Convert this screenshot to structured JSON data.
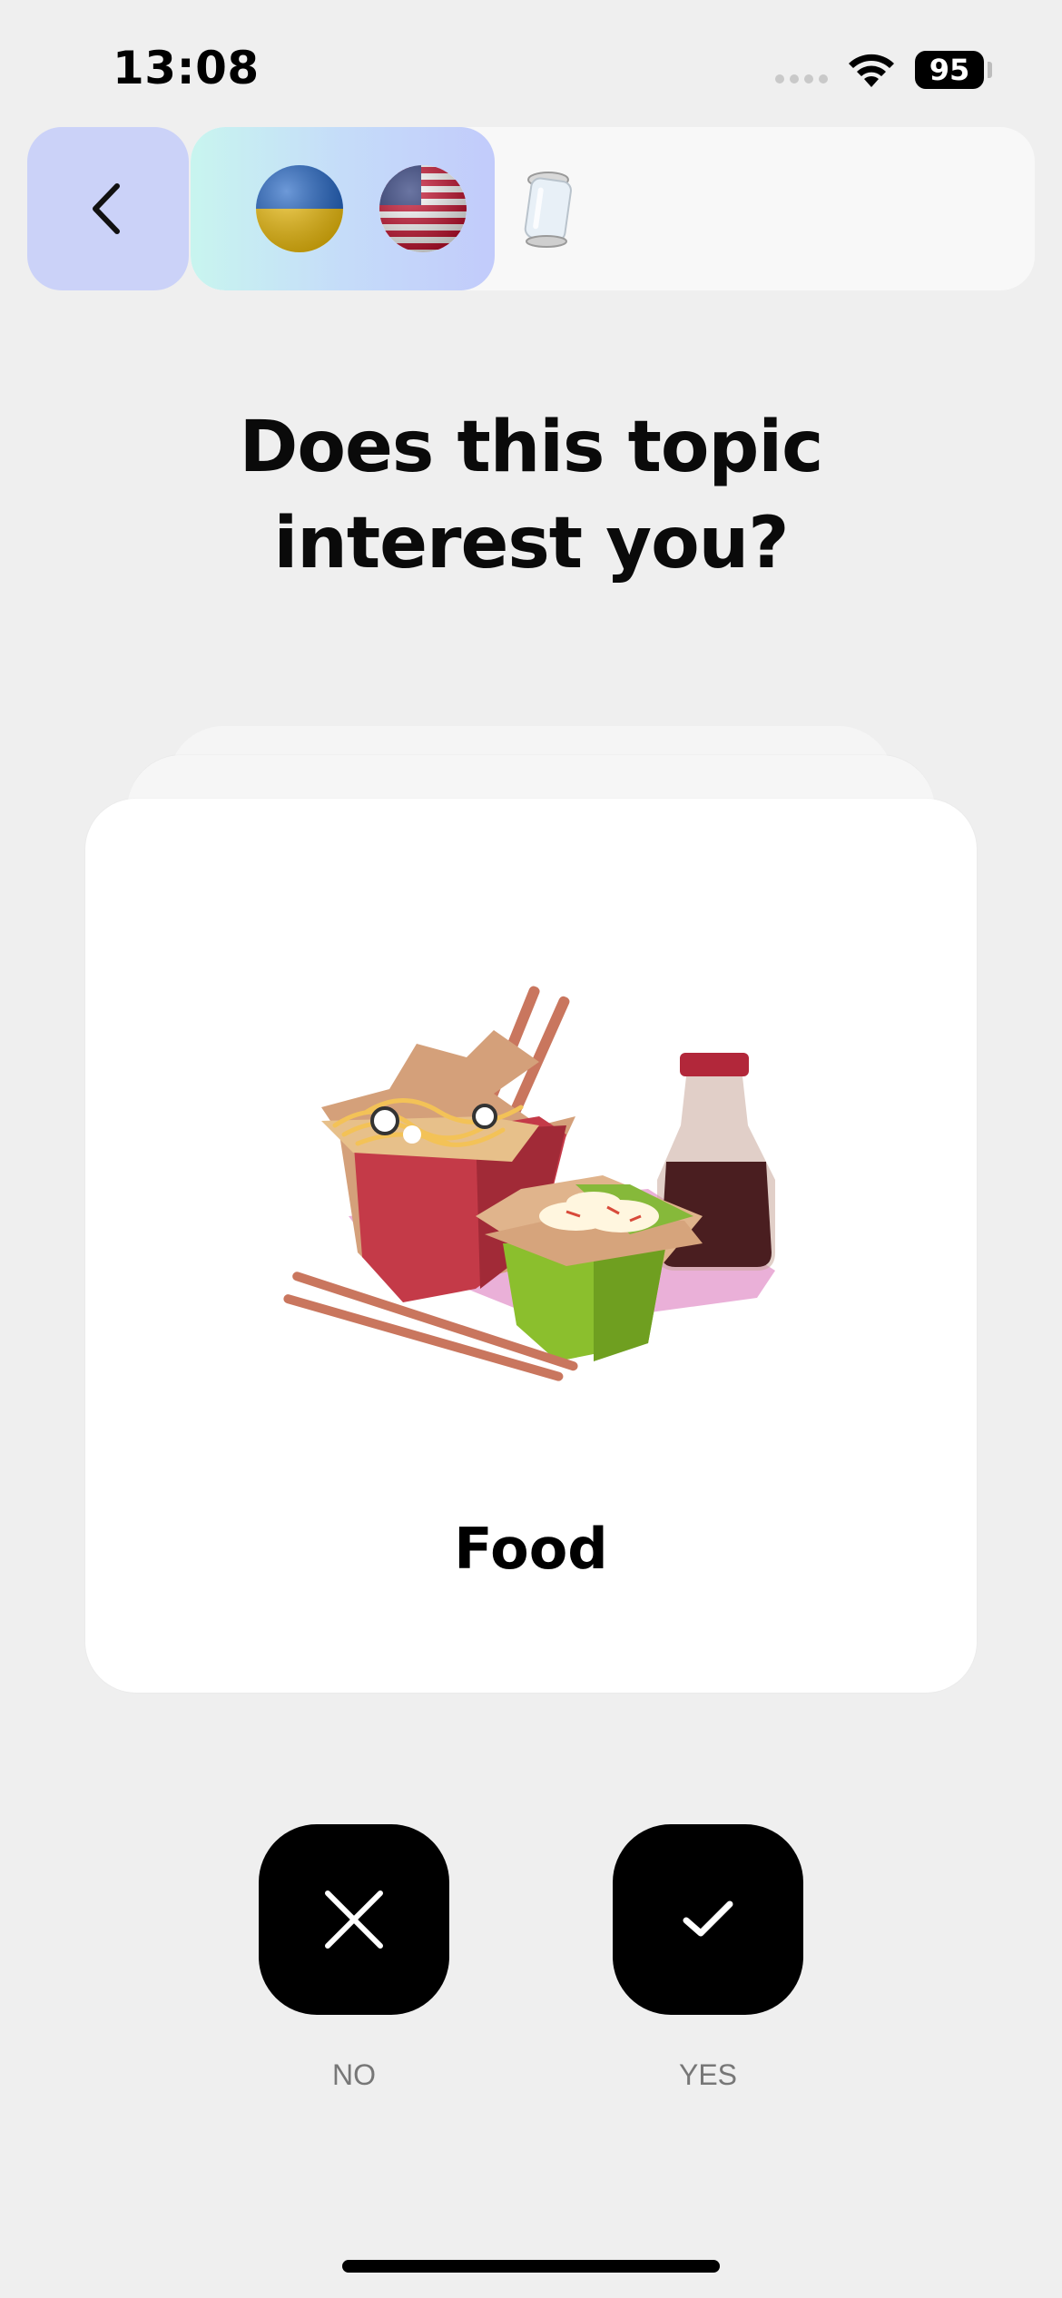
{
  "status_bar": {
    "time": "13:08",
    "battery": "95",
    "icons": [
      "signal-dots-icon",
      "wifi-icon",
      "battery-icon"
    ]
  },
  "header": {
    "back_icon": "chevron-left-icon",
    "progress_fraction": 0.36,
    "progress_icons": [
      "ukraine-flag-globe-icon",
      "usa-flag-globe-icon",
      "glass-jar-icon"
    ]
  },
  "question": {
    "line1": "Does this topic",
    "line2": "interest you?"
  },
  "card": {
    "illustration": "takeout-noodles-illustration",
    "topic": "Food"
  },
  "actions": {
    "no_label": "NO",
    "yes_label": "YES",
    "no_icon": "close-x-icon",
    "yes_icon": "checkmark-icon"
  },
  "colors": {
    "background": "#efefef",
    "back_button": "#cbd2f8",
    "progress_gradient_start": "#c8f5ef",
    "progress_gradient_end": "#c2cbfb",
    "action_button": "#000000"
  }
}
